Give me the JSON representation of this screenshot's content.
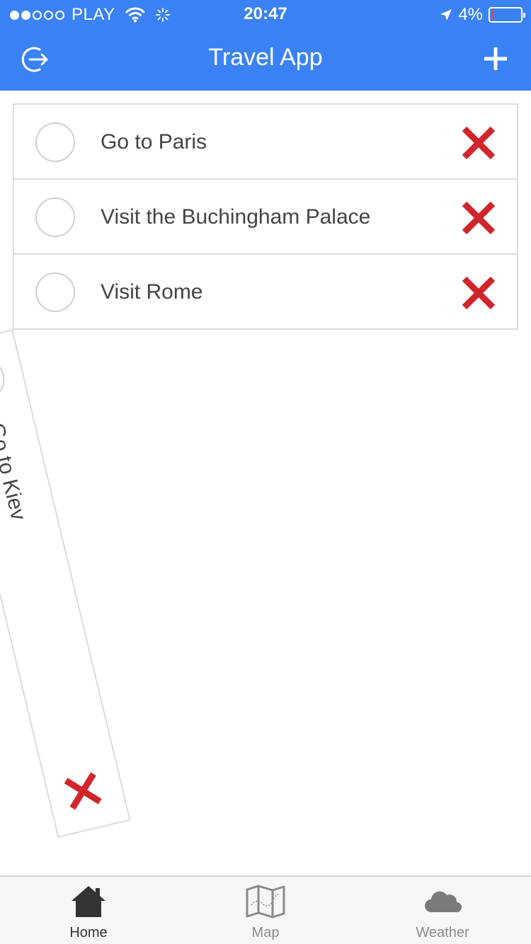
{
  "status_bar": {
    "carrier": "PLAY",
    "time": "20:47",
    "battery": "4%",
    "battery_level": 0.04
  },
  "header": {
    "title": "Travel App",
    "logout_icon": "logout-icon",
    "add_icon": "plus-icon"
  },
  "todos": [
    {
      "label": "Go to Paris",
      "done": false
    },
    {
      "label": "Visit the Buchingham Palace",
      "done": false
    },
    {
      "label": "Visit Rome",
      "done": false
    }
  ],
  "falling_todo": {
    "label": "Go to Kiev",
    "done": false
  },
  "tabs": [
    {
      "label": "Home",
      "icon": "home-icon",
      "active": true
    },
    {
      "label": "Map",
      "icon": "map-icon",
      "active": false
    },
    {
      "label": "Weather",
      "icon": "cloud-icon",
      "active": false
    }
  ],
  "colors": {
    "header": "#3a82f6",
    "delete": "#d0252b",
    "battery_low": "#ff3b30"
  }
}
